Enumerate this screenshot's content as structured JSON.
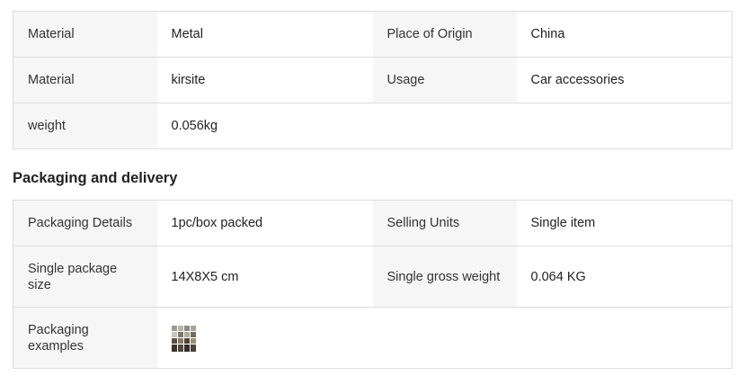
{
  "attributes": [
    {
      "label1": "Material",
      "value1": "Metal",
      "label2": "Place of Origin",
      "value2": "China"
    },
    {
      "label1": "Material",
      "value1": "kirsite",
      "label2": "Usage",
      "value2": "Car accessories"
    },
    {
      "label1": "weight",
      "value1": "0.056kg",
      "label2": "",
      "value2": ""
    }
  ],
  "packaging": {
    "title": "Packaging and delivery",
    "rows": [
      {
        "label1": "Packaging Details",
        "value1": "1pc/box packed",
        "label2": "Selling Units",
        "value2": "Single item"
      },
      {
        "label1": "Single package size",
        "value1": "14X8X5 cm",
        "label2": "Single gross weight",
        "value2": "0.064 KG"
      },
      {
        "label1": "Packaging examples",
        "label2": "",
        "value2": ""
      }
    ],
    "example_image_icon": "packaging-example-thumbnail"
  },
  "colors": {
    "key_cell_bg": "#f6f6f6",
    "border": "#dddddd",
    "text": "#222222"
  }
}
